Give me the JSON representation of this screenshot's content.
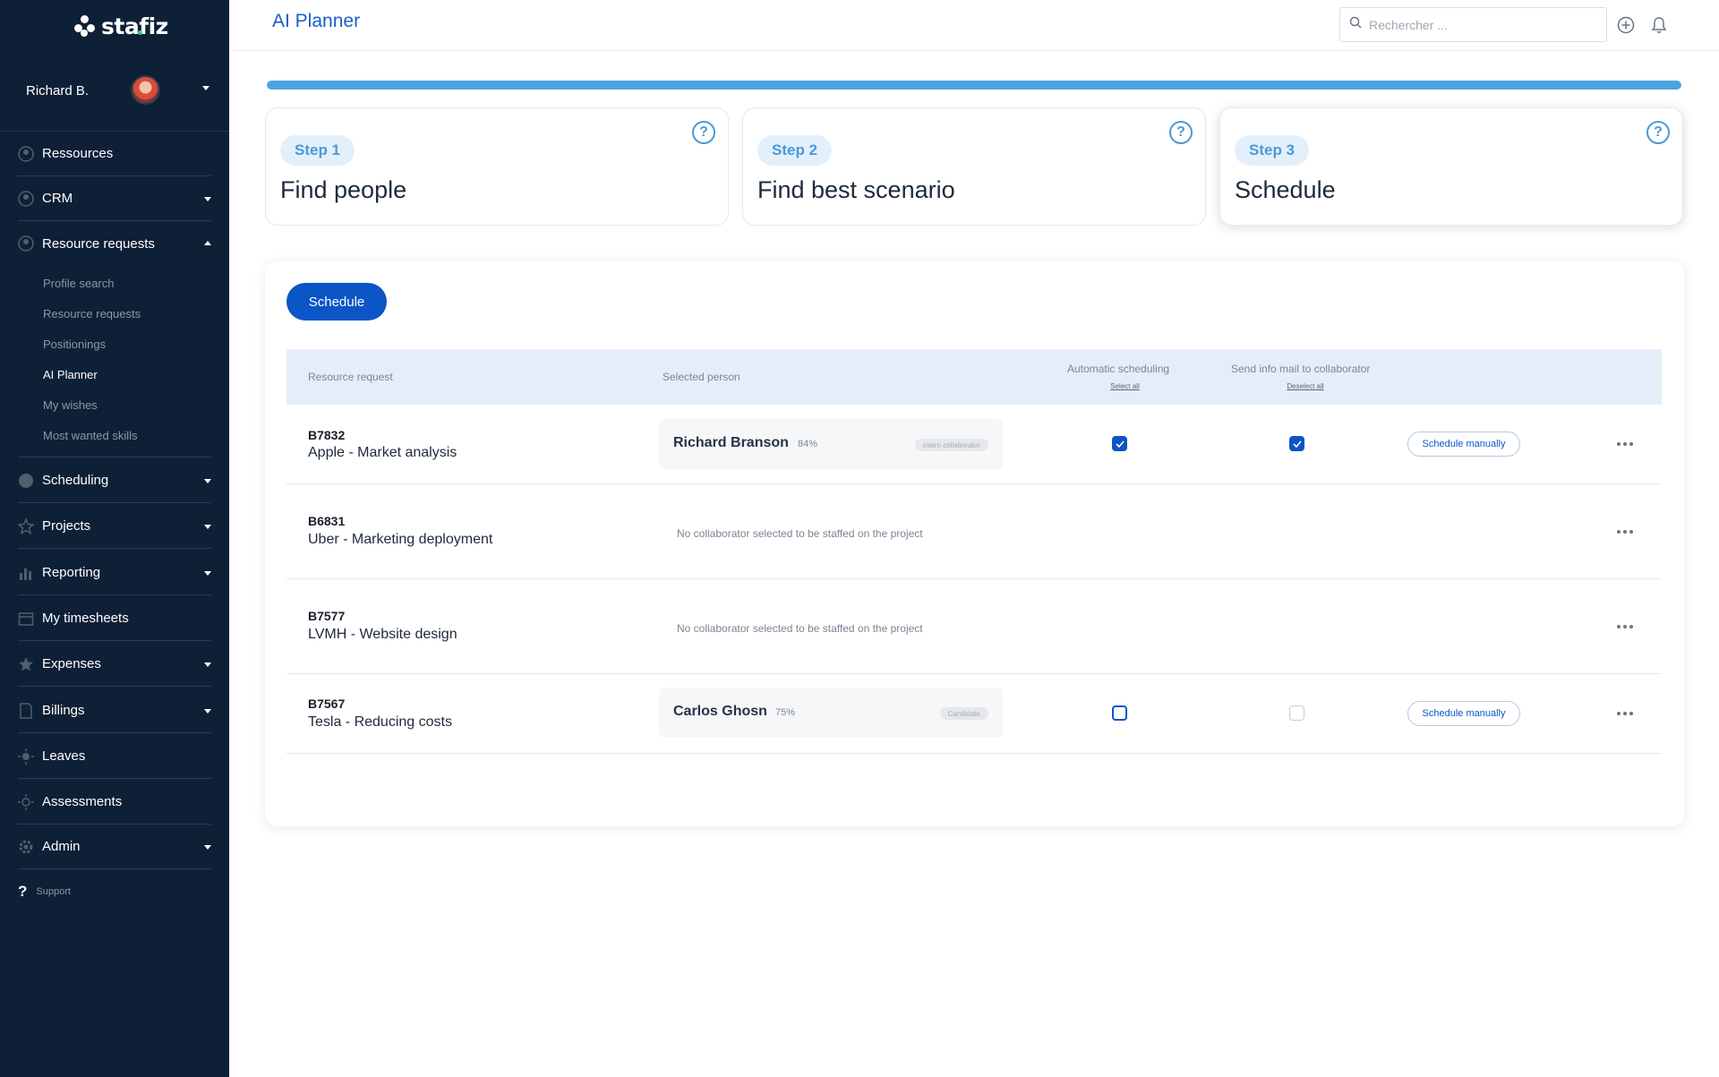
{
  "brand": {
    "name": "stafiz",
    "dot_color": "#2fd3a1"
  },
  "user": {
    "name": "Richard B."
  },
  "nav": {
    "ressources": "Ressources",
    "crm": "CRM",
    "resource_requests": "Resource requests",
    "sub": [
      "Profile search",
      "Resource requests",
      "Positionings",
      "AI Planner",
      "My wishes",
      "Most wanted skills"
    ],
    "scheduling": "Scheduling",
    "projects": "Projects",
    "reporting": "Reporting",
    "timesheets": "My timesheets",
    "expenses": "Expenses",
    "billings": "Billings",
    "leaves": "Leaves",
    "assessments": "Assessments",
    "admin": "Admin",
    "support": "Support"
  },
  "header": {
    "title": "AI Planner",
    "search_placeholder": "Rechercher ..."
  },
  "progress": {
    "value_percent": 100
  },
  "steps": [
    {
      "badge": "Step 1",
      "title": "Find people",
      "help": "?"
    },
    {
      "badge": "Step 2",
      "title": "Find best scenario",
      "help": "?"
    },
    {
      "badge": "Step 3",
      "title": "Schedule",
      "help": "?"
    }
  ],
  "schedule_button": "Schedule",
  "table": {
    "col_request": "Resource request",
    "col_person": "Selected person",
    "col_auto": "Automatic scheduling",
    "col_auto_link": "Select all",
    "col_mail": "Send info mail to collaborator",
    "col_mail_link": "Deselect all",
    "rows": [
      {
        "code": "B7832",
        "name": "Apple - Market analysis",
        "person": "Richard Branson",
        "pct": "84%",
        "tag": "intern collaborator",
        "auto": true,
        "mail": true,
        "action": "Schedule manually"
      },
      {
        "code": "B6831",
        "name": "Uber - Marketing deployment",
        "empty": "No collaborator selected to be staffed on the project"
      },
      {
        "code": "B7577",
        "name": "LVMH - Website design",
        "empty": "No collaborator selected to be staffed on the project"
      },
      {
        "code": "B7567",
        "name": "Tesla - Reducing costs",
        "person": "Carlos Ghosn",
        "pct": "75%",
        "tag": "Candidate",
        "auto": false,
        "mail": false,
        "action": "Schedule manually"
      }
    ]
  },
  "colors": {
    "accent": "#0b55c6",
    "sidebar": "#0e2036",
    "step_accent": "#4a9ad8"
  }
}
